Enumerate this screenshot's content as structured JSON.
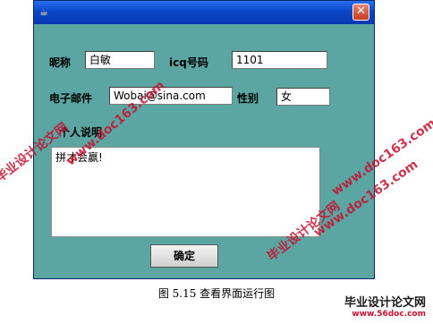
{
  "window": {
    "icon": "java-cup-icon",
    "close_symbol": "✕"
  },
  "form": {
    "nickname_label": "昵称",
    "nickname_value": "白敏",
    "icq_label": "icq号码",
    "icq_value": "1101",
    "email_label": "电子邮件",
    "email_value": "Wobai@sina.com",
    "gender_label": "性别",
    "gender_value": "女",
    "intro_label": "个人说明",
    "intro_value": "拼才会赢!",
    "ok_label": "确定"
  },
  "caption": "图 5.15 查看界面运行图",
  "watermarks": {
    "site": "www.doc163.com",
    "cn": "毕业设计论文网",
    "logo_cn": "毕业设计论文网",
    "logo_url": "www.56doc.com"
  },
  "colors": {
    "panel": "#5ba6a3",
    "titlebar": "#0a46c8",
    "watermark": "#c8102e"
  }
}
